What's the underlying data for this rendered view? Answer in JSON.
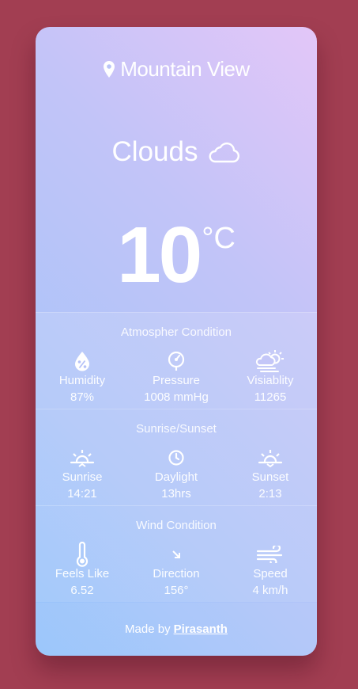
{
  "location": "Mountain View",
  "weather": {
    "condition": "Clouds",
    "temperature": "10",
    "unit": "°C"
  },
  "atmosphere": {
    "title": "Atmospher Condition",
    "items": [
      {
        "label": "Humidity",
        "value": "87%",
        "icon": "humidity-icon"
      },
      {
        "label": "Pressure",
        "value": "1008 mmHg",
        "icon": "pressure-icon"
      },
      {
        "label": "Visiablity",
        "value": "11265",
        "icon": "visibility-icon"
      }
    ]
  },
  "sun": {
    "title": "Sunrise/Sunset",
    "items": [
      {
        "label": "Sunrise",
        "value": "14:21",
        "icon": "sunrise-icon"
      },
      {
        "label": "Daylight",
        "value": "13hrs",
        "icon": "clock-icon"
      },
      {
        "label": "Sunset",
        "value": "2:13",
        "icon": "sunset-icon"
      }
    ]
  },
  "wind": {
    "title": "Wind Condition",
    "items": [
      {
        "label": "Feels Like",
        "value": "6.52",
        "icon": "thermometer-icon"
      },
      {
        "label": "Direction",
        "value": "156°",
        "icon": "arrow-icon"
      },
      {
        "label": "Speed",
        "value": "4 km/h",
        "icon": "wind-icon"
      }
    ]
  },
  "footer": {
    "prefix": "Made by",
    "author": "Pirasanth"
  }
}
